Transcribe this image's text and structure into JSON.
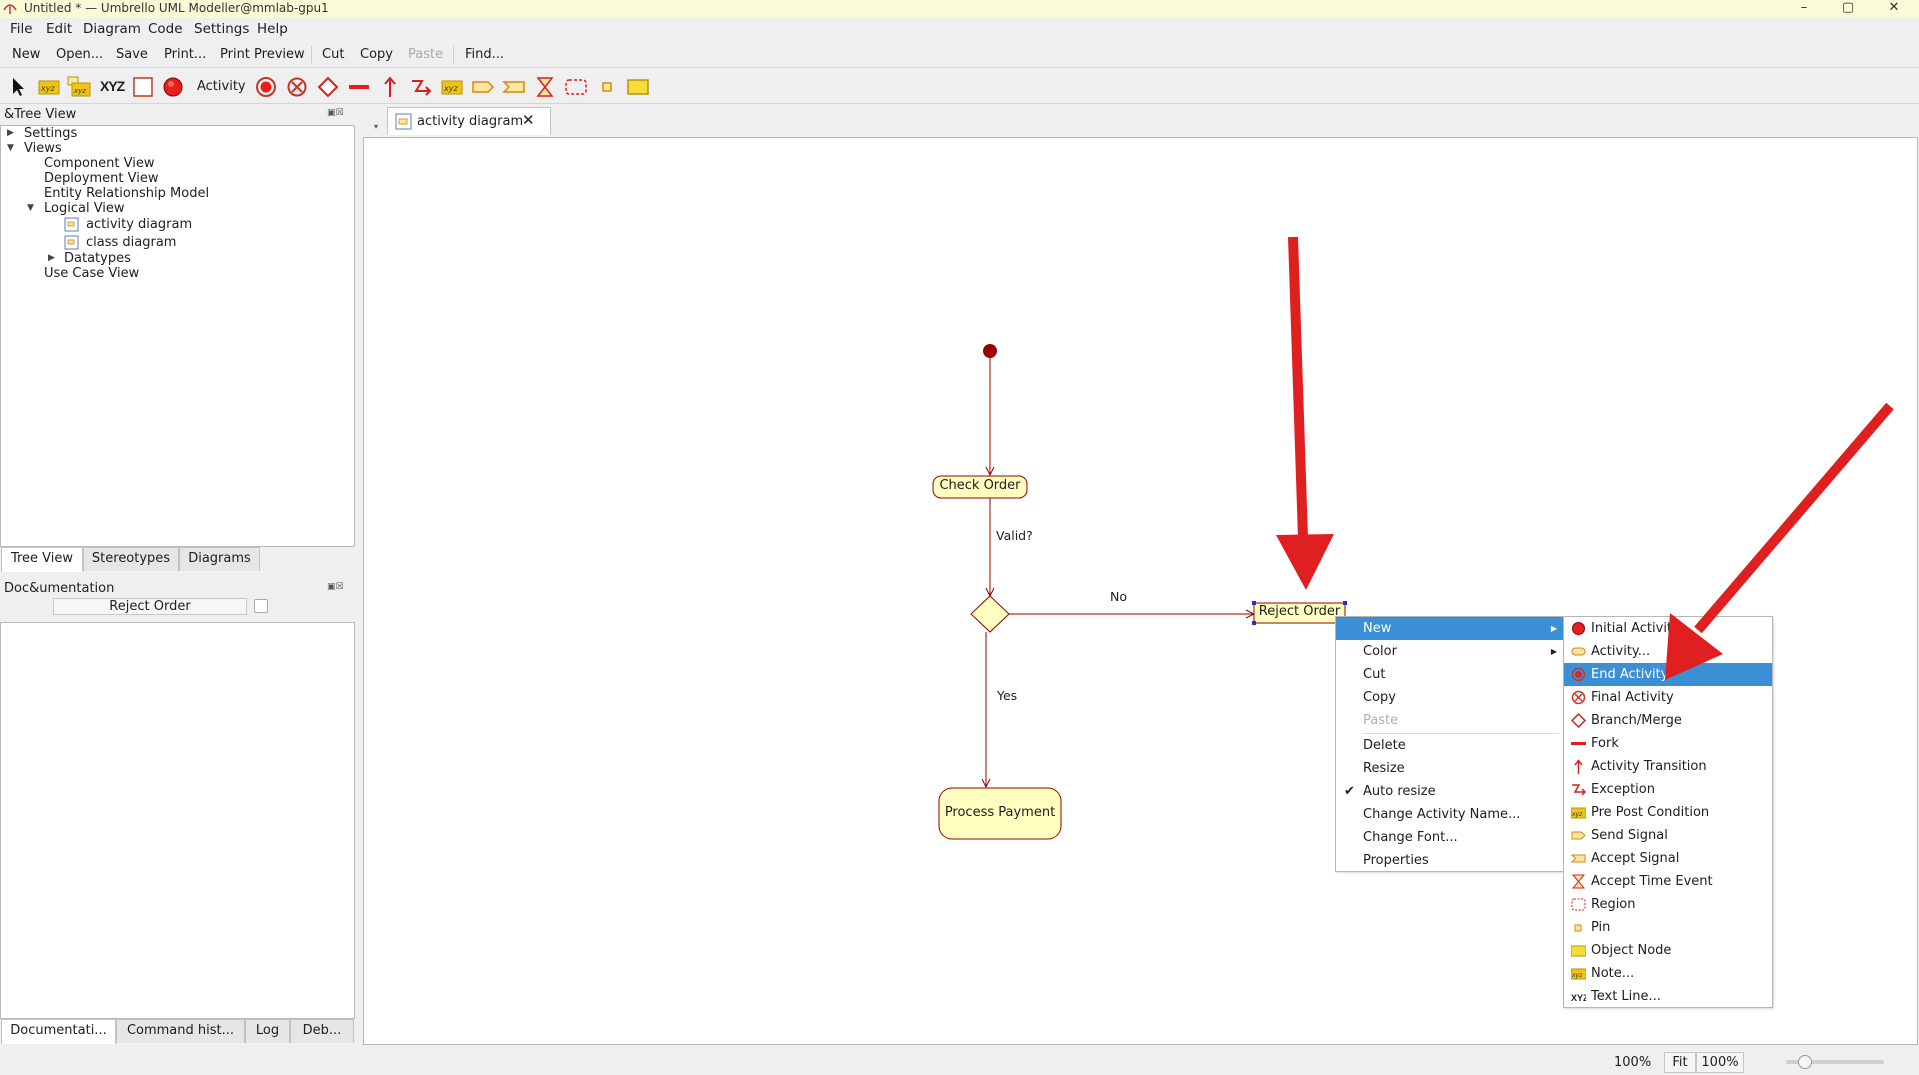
{
  "window": {
    "title": "Untitled * — Umbrello UML Modeller@mmlab-gpu1",
    "buttons": [
      "–",
      "▢",
      "✕"
    ]
  },
  "menubar": [
    "File",
    "Edit",
    "Diagram",
    "Code",
    "Settings",
    "Help"
  ],
  "toolbar": {
    "new": "New",
    "open": "Open...",
    "save": "Save",
    "print": "Print...",
    "print_preview": "Print Preview",
    "cut": "Cut",
    "copy": "Copy",
    "paste": "Paste",
    "find": "Find..."
  },
  "diagram_toolbar": {
    "activity_label": "Activity",
    "xyz_label": "XYZ",
    "tools": [
      "select-arrow",
      "object-node-xyz",
      "pre-post-xyz",
      "text-line-xyz",
      "region-box",
      "initial-activity",
      "activity",
      "end-activity",
      "final-activity",
      "branch-merge",
      "fork",
      "activity-transition",
      "exception",
      "pre-post-condition",
      "send-signal",
      "accept-signal",
      "accept-time-event",
      "region",
      "pin",
      "object-node"
    ]
  },
  "tree_panel": {
    "title": "&Tree View",
    "items": [
      {
        "label": "Settings",
        "expanded": false
      },
      {
        "label": "Views",
        "expanded": true
      },
      {
        "label": "Component View"
      },
      {
        "label": "Deployment View"
      },
      {
        "label": "Entity Relationship Model"
      },
      {
        "label": "Logical View",
        "expanded": true
      },
      {
        "label": "activity diagram"
      },
      {
        "label": "class diagram"
      },
      {
        "label": "Datatypes",
        "expanded": false
      },
      {
        "label": "Use Case View"
      }
    ],
    "tabs": [
      "Tree View",
      "Stereotypes",
      "Diagrams"
    ]
  },
  "doc_panel": {
    "title": "Doc&umentation",
    "name_value": "Reject Order",
    "tabs": [
      "Documentati...",
      "Command hist...",
      "Log",
      "Deb..."
    ]
  },
  "diagram_tab": {
    "label": "activity diagram",
    "close": "✕"
  },
  "diagram": {
    "nodes": {
      "check_order": "Check Order",
      "reject_order": "Reject Order",
      "process_payment": "Process Payment"
    },
    "edge_labels": {
      "valid": "Valid?",
      "no": "No",
      "yes": "Yes"
    }
  },
  "context_menu": {
    "items": [
      {
        "label": "New",
        "submenu": true,
        "highlighted": true
      },
      {
        "label": "Color",
        "submenu": true
      },
      {
        "label": "Cut"
      },
      {
        "label": "Copy"
      },
      {
        "label": "Paste",
        "disabled": true
      },
      {
        "label": "Delete"
      },
      {
        "label": "Resize"
      },
      {
        "label": "Auto resize",
        "checked": true
      },
      {
        "label": "Change Activity Name..."
      },
      {
        "label": "Change Font..."
      },
      {
        "label": "Properties"
      }
    ]
  },
  "submenu": {
    "items": [
      {
        "label": "Initial Activity",
        "icon": "initial-activity-icon"
      },
      {
        "label": "Activity...",
        "icon": "activity-icon"
      },
      {
        "label": "End Activity",
        "icon": "end-activity-icon",
        "highlighted": true
      },
      {
        "label": "Final Activity",
        "icon": "final-activity-icon"
      },
      {
        "label": "Branch/Merge",
        "icon": "branch-merge-icon"
      },
      {
        "label": "Fork",
        "icon": "fork-icon"
      },
      {
        "label": "Activity Transition",
        "icon": "activity-transition-icon"
      },
      {
        "label": "Exception",
        "icon": "exception-icon"
      },
      {
        "label": "Pre Post Condition",
        "icon": "pre-post-condition-icon"
      },
      {
        "label": "Send Signal",
        "icon": "send-signal-icon"
      },
      {
        "label": "Accept Signal",
        "icon": "accept-signal-icon"
      },
      {
        "label": "Accept Time Event",
        "icon": "accept-time-event-icon"
      },
      {
        "label": "Region",
        "icon": "region-icon"
      },
      {
        "label": "Pin",
        "icon": "pin-icon"
      },
      {
        "label": "Object Node",
        "icon": "object-node-icon"
      },
      {
        "label": "Note...",
        "icon": "note-icon"
      },
      {
        "label": "Text Line...",
        "icon": "text-line-icon"
      }
    ]
  },
  "statusbar": {
    "zoom_text": "100%",
    "fit": "Fit",
    "zoom_box": "100%",
    "zoom_slider_percent": 100
  },
  "colors": {
    "uml_fill": "#ffffc0",
    "uml_stroke": "#990000",
    "menu_highlight": "#3b8fd4",
    "annotation_arrow": "#e02020",
    "titlebar": "#fafad6"
  }
}
